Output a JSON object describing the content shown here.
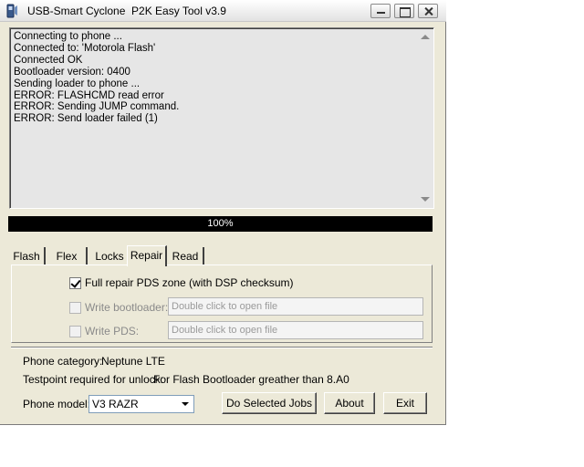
{
  "window": {
    "title": "USB-Smart Cyclone  P2K Easy Tool v3.9",
    "app_icon": "phone-tool-icon",
    "controls": [
      "minimize-icon",
      "maximize-icon",
      "close-icon"
    ]
  },
  "log": {
    "lines": [
      "Connecting to phone ...",
      "Connected to: 'Motorola Flash'",
      "Connected OK",
      "Bootloader version: 0400",
      "Sending loader to phone ...",
      "ERROR: FLASHCMD read error",
      "ERROR: Sending JUMP command.",
      "ERROR: Send loader failed (1)"
    ]
  },
  "progress": {
    "text": "100%",
    "value": 1.0,
    "color": "#000000"
  },
  "tabs": [
    {
      "label": "Flash",
      "active": false
    },
    {
      "label": "Flex",
      "active": false
    },
    {
      "label": "Locks",
      "active": false
    },
    {
      "label": "Repair",
      "active": true
    },
    {
      "label": "Read",
      "active": false
    }
  ],
  "repair": {
    "full_repair": {
      "label": "Full repair PDS zone (with DSP checksum)",
      "checked": true
    },
    "write_bootloader": {
      "label": "Write bootloader:",
      "checked": false,
      "placeholder": "Double click to open file"
    },
    "write_pds": {
      "label": "Write PDS:",
      "checked": false,
      "placeholder": "Double click to open file"
    }
  },
  "info": {
    "phone_category_label": "Phone category:",
    "phone_category_value": "Neptune LTE",
    "testpoint_label": "Testpoint required for unlock:",
    "testpoint_value": "For Flash Bootloader greather than 8.A0"
  },
  "bottom": {
    "phone_model_label": "Phone model:",
    "phone_model_value": "V3 RAZR",
    "do_jobs_label": "Do Selected Jobs",
    "about_label": "About",
    "exit_label": "Exit"
  }
}
